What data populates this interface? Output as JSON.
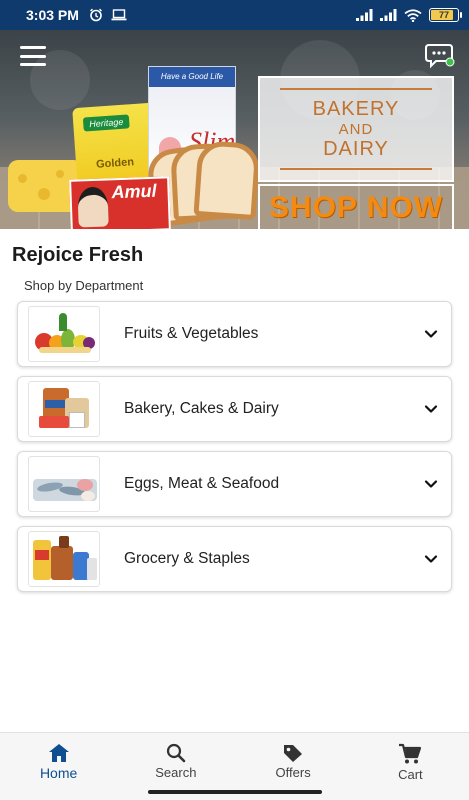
{
  "status_bar": {
    "time": "3:03 PM",
    "battery": "77"
  },
  "banner": {
    "promo_line1": "BAKERY",
    "promo_line2": "AND",
    "promo_line3": "DAIRY",
    "cta": "SHOP NOW",
    "brand_amul": "Amul",
    "brand_slim": "Slim",
    "brand_heritage": "Heritage",
    "product_golden": "Golden",
    "slim_tagline": "Have a Good Life"
  },
  "page": {
    "title": "Rejoice Fresh",
    "section_label": "Shop by Department"
  },
  "departments": [
    {
      "name": "Fruits & Vegetables",
      "icon": "fruits-vegetables-image"
    },
    {
      "name": "Bakery, Cakes & Dairy",
      "icon": "bakery-dairy-image"
    },
    {
      "name": "Eggs, Meat & Seafood",
      "icon": "eggs-meat-seafood-image"
    },
    {
      "name": "Grocery & Staples",
      "icon": "grocery-staples-image"
    }
  ],
  "bottom_nav": [
    {
      "label": "Home",
      "icon": "home-icon",
      "active": true
    },
    {
      "label": "Search",
      "icon": "search-icon",
      "active": false
    },
    {
      "label": "Offers",
      "icon": "tag-icon",
      "active": false
    },
    {
      "label": "Cart",
      "icon": "cart-icon",
      "active": false
    }
  ],
  "colors": {
    "status_bar": "#0f3a6e",
    "accent": "#0f4f8f",
    "promo_text": "#c0722e",
    "cta": "#f38b12"
  }
}
